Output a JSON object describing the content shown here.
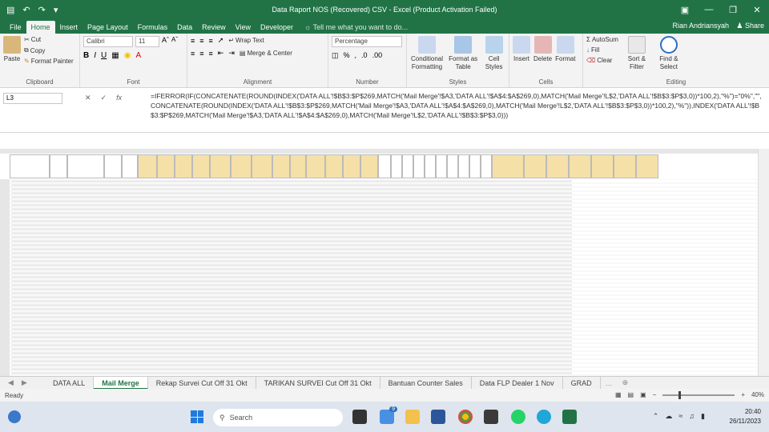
{
  "window": {
    "title": "Data Raport NOS (Recovered) CSV - Excel (Product Activation Failed)",
    "qat_icons": [
      "save-icon",
      "undo-icon",
      "redo-icon",
      "customize-qat-icon"
    ],
    "controls": [
      "ribbon-display-icon",
      "minimize-icon",
      "restore-icon",
      "close-icon"
    ]
  },
  "ribbon_tabs": [
    "File",
    "Home",
    "Insert",
    "Page Layout",
    "Formulas",
    "Data",
    "Review",
    "View",
    "Developer"
  ],
  "active_tab": "Home",
  "tell_me": "Tell me what you want to do...",
  "user": "Rian Andriansyah",
  "share": "Share",
  "ribbon": {
    "clipboard": {
      "paste": "Paste",
      "cut": "Cut",
      "copy": "Copy",
      "format_painter": "Format Painter",
      "label": "Clipboard"
    },
    "font": {
      "name": "Calibri",
      "size": "11",
      "label": "Font"
    },
    "alignment": {
      "wrap": "Wrap Text",
      "merge": "Merge & Center",
      "label": "Alignment"
    },
    "number": {
      "format": "Percentage",
      "label": "Number"
    },
    "styles": {
      "cond": "Conditional Formatting",
      "table": "Format as Table",
      "cell": "Cell Styles",
      "label": "Styles"
    },
    "cells": {
      "insert": "Insert",
      "delete": "Delete",
      "format": "Format",
      "label": "Cells"
    },
    "editing": {
      "autosum": "AutoSum",
      "fill": "Fill",
      "clear": "Clear",
      "sort": "Sort & Filter",
      "find": "Find & Select",
      "label": "Editing"
    }
  },
  "formula_bar": {
    "name_box": "L3",
    "formula": "=IFERROR(IF(CONCATENATE(ROUND(INDEX('DATA ALL'!$B$3:$P$269,MATCH('Mail Merge'!$A3,'DATA ALL'!$A$4:$A$269,0),MATCH('Mail Merge'!L$2,'DATA ALL'!$B$3:$P$3,0))*100,2),\"%\")=\"0%\",\"\",CONCATENATE(ROUND(INDEX('DATA ALL'!$B$3:$P$269,MATCH('Mail Merge'!$A3,'DATA ALL'!$A$4:$A$269,0),MATCH('Mail Merge'!L$2,'DATA ALL'!$B$3:$P$3,0))*100,2),\"%\")),INDEX('DATA ALL'!$B$3:$P$269,MATCH('Mail Merge'!$A3,'DATA ALL'!$A$4:$A$269,0),MATCH('Mail Merge'!L$2,'DATA ALL'!$B$3:$P$3,0)))"
  },
  "sheet_tabs": [
    "DATA ALL",
    "Mail Merge",
    "Rekap Survei Cut Off 31 Okt",
    "TARIKAN SURVEI Cut Off 31 Okt",
    "Bantuan Counter Sales",
    "Data FLP Dealer 1 Nov",
    "GRAD"
  ],
  "active_sheet": "Mail Merge",
  "status": {
    "left": "Ready",
    "zoom": "40%"
  },
  "taskbar": {
    "search": "Search",
    "time": "20:40",
    "date": "26/11/2023",
    "badge": "9"
  },
  "colors": {
    "excel_green": "#217346",
    "header_yellow": "#f5e0a8",
    "header_white": "#ffffff"
  }
}
